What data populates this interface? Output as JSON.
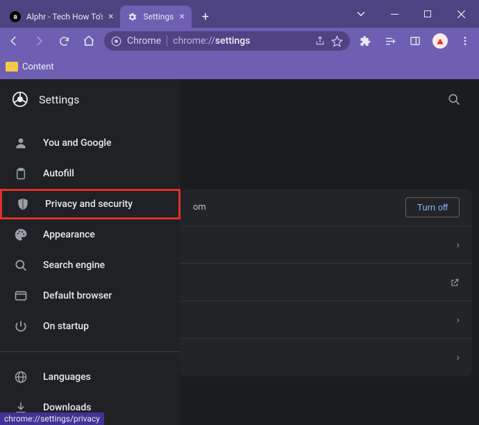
{
  "tabs": [
    {
      "title": "Alphr - Tech How To's & G"
    },
    {
      "title": "Settings"
    }
  ],
  "address": {
    "prefix": "Chrome",
    "url_grey": "chrome://",
    "url_bold": "settings"
  },
  "bookmarks": {
    "content": "Content"
  },
  "settings_title": "Settings",
  "sidebar": {
    "items": [
      {
        "label": "You and Google"
      },
      {
        "label": "Autofill"
      },
      {
        "label": "Privacy and security"
      },
      {
        "label": "Appearance"
      },
      {
        "label": "Search engine"
      },
      {
        "label": "Default browser"
      },
      {
        "label": "On startup"
      }
    ],
    "items2": [
      {
        "label": "Languages"
      },
      {
        "label": "Downloads"
      }
    ]
  },
  "main": {
    "top_frag": "om",
    "turn_off": "Turn off"
  },
  "status_url": "chrome://settings/privacy"
}
